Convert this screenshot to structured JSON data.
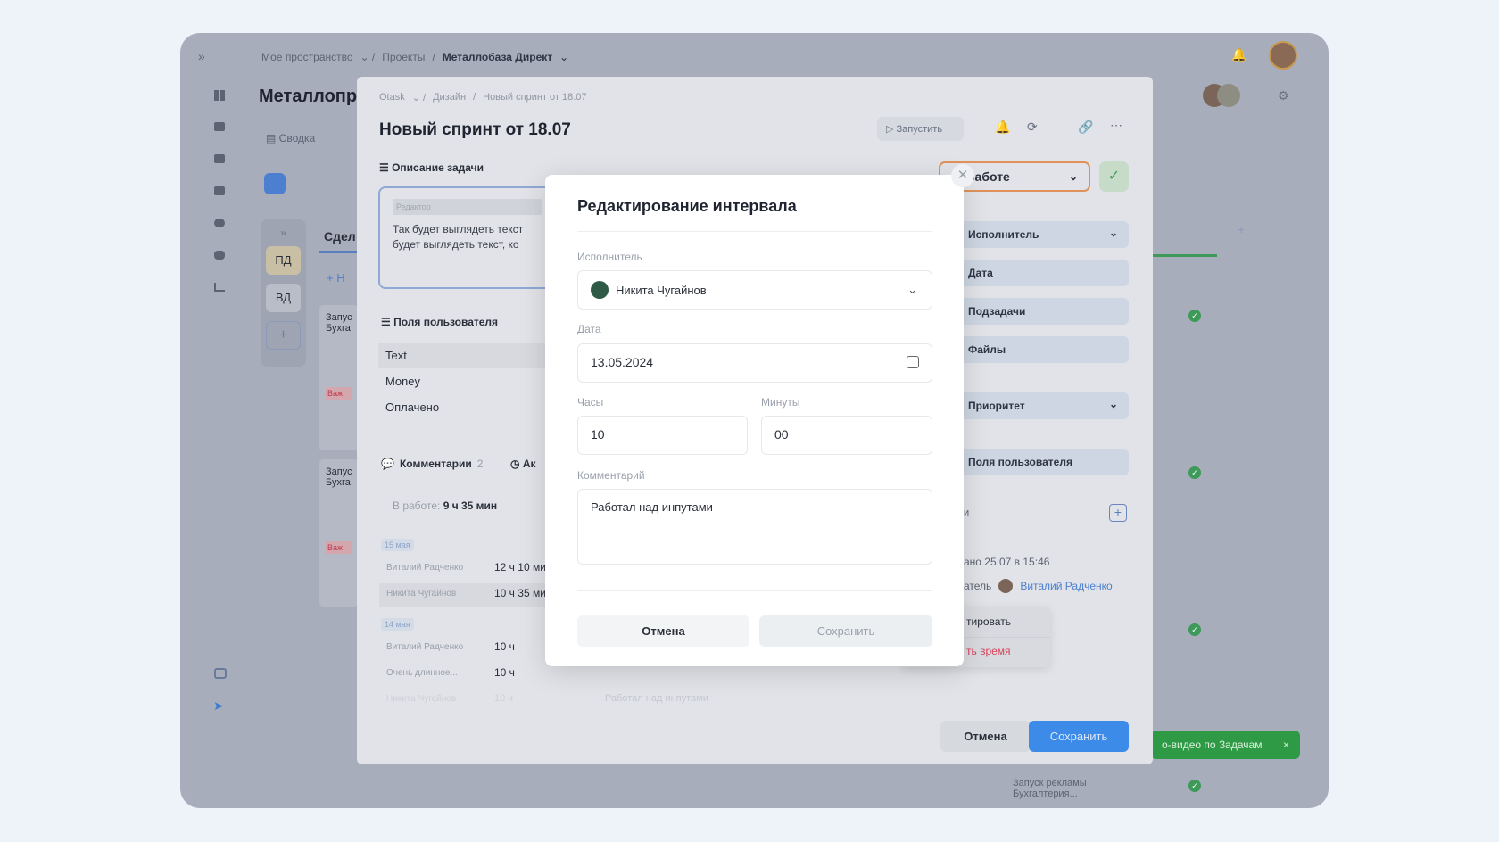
{
  "topbar": {
    "expand": "»",
    "breadcrumbs": [
      "Мое пространство",
      "Проекты",
      "Металлобаза Директ"
    ],
    "bell": "bell-icon",
    "avatar": "avatar"
  },
  "sidebar": {
    "icons": [
      "grid-icon",
      "home-icon",
      "board-icon",
      "briefcase-icon",
      "users-icon",
      "database-icon",
      "branch-icon"
    ],
    "bottom_icons": [
      "help-icon",
      "telegram-icon"
    ]
  },
  "project": {
    "title": "Металлопр",
    "tab_summary": "Сводка",
    "column_title": "Сдел",
    "add": "+ Н",
    "columns": [
      "»",
      "ПД",
      "ВД",
      "+"
    ],
    "cards": [
      {
        "title1": "Запус",
        "title2": "Бухга",
        "tag": "Важ"
      },
      {
        "title1": "Запус",
        "title2": "Бухга",
        "tag": "Важ"
      }
    ],
    "bottom_card": {
      "title1": "Запуск рекламы",
      "title2": "Бухгалтерия..."
    },
    "toast": "о-видео по Задачам",
    "toast_close": "×"
  },
  "task": {
    "breadcrumbs": [
      "Otask",
      "Дизайн",
      "Новый спринт от 18.07"
    ],
    "title": "Новый спринт от 18.07",
    "run": "Запустить",
    "description_header": "Описание задачи",
    "editor_label": "Редактор",
    "editor_text": "Так будет выглядеть текст будет выглядеть текст, ко",
    "user_fields_header": "Поля пользователя",
    "user_fields": [
      "Text",
      "Money",
      "Оплачено"
    ],
    "comments_tab": "Комментарии",
    "comments_count": "2",
    "activity_tab": "Ак",
    "in_work_label": "В работе:",
    "in_work_value": "9 ч 35 мин",
    "groups": [
      {
        "date": "15 мая",
        "rows": [
          {
            "name": "Виталий Радченко",
            "time": "12 ч 10 ми"
          },
          {
            "name": "Никита Чугайнов",
            "time": "10 ч 35 ми"
          }
        ]
      },
      {
        "date": "14 мая",
        "rows": [
          {
            "name": "Виталий Радченко",
            "time": "10 ч"
          },
          {
            "name": "Очень длинное...",
            "time": "10 ч"
          },
          {
            "name": "Никита Чугайнов",
            "time": "10 ч",
            "comment": "Работал над инпутами"
          }
        ]
      }
    ],
    "status": "работе",
    "side_items": [
      "Исполнитель",
      "Дата",
      "Подзадачи",
      "Файлы",
      "Приоритет",
      "Поля пользователя"
    ],
    "sub_label": "и",
    "created": "ано 25.07 в 15:46",
    "creator_label": "атель",
    "creator": "Виталий Радченко",
    "menu": [
      "тировать",
      "ть время"
    ],
    "cancel": "Отмена",
    "save": "Сохранить"
  },
  "modal": {
    "title": "Редактирование интервала",
    "assignee_label": "Исполнитель",
    "assignee": "Никита Чугайнов",
    "date_label": "Дата",
    "date": "13.05.2024",
    "hours_label": "Часы",
    "hours": "10",
    "minutes_label": "Минуты",
    "minutes": "00",
    "comment_label": "Комментарий",
    "comment": "Работал над инпутами",
    "cancel": "Отмена",
    "save": "Сохранить"
  },
  "colors": {
    "accent": "#3d8be8",
    "success": "#3e9a58",
    "danger": "#d9435a",
    "status_border": "#e0925a"
  }
}
